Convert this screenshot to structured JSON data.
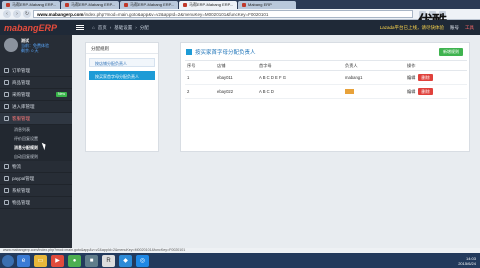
{
  "browser": {
    "tabs": [
      {
        "label": "马帮ERP-Mabang ERP..."
      },
      {
        "label": "马帮ERP-Mabang ERP..."
      },
      {
        "label": "马帮ERP-Mabang ERP..."
      },
      {
        "label": "马帮ERP-Mabang ERP..."
      },
      {
        "label": "Mabang ERP"
      }
    ],
    "url_domain": "www.mabangerp.com",
    "url_path": "/index.php?mod=main.goto&app&v=v2&appId=2&menuKey=M0020101&funcKey=F0020101",
    "status_url": "www.mabangerp.com/index.php?mod=main.goto&app&v=v2&appId=2&menuKey=M0020101&funcKey=F0020101"
  },
  "header": {
    "logo_main": "mabang",
    "logo_accent": "ERP",
    "breadcrumb": [
      "首页",
      "基础设置",
      "分配"
    ],
    "notice": "Lazada平台已上线，请尽快体验",
    "user": "账号",
    "tool": "工具"
  },
  "sidebar": {
    "user_name": "测试",
    "user_line1": "当前：免费体验",
    "user_line2": "剩余: 0 天",
    "items": [
      {
        "label": "订单管理"
      },
      {
        "label": "商品管理"
      },
      {
        "label": "采购管理",
        "badge": "New"
      },
      {
        "label": "进入库管理"
      },
      {
        "label": "客服管理"
      }
    ],
    "subitems": [
      {
        "label": "消息列表"
      },
      {
        "label": "评价回复设置"
      },
      {
        "label": "消息分配规则"
      },
      {
        "label": "自动回复规则"
      }
    ],
    "items_after": [
      {
        "label": "物流"
      },
      {
        "label": "paypal管理"
      },
      {
        "label": "系统管理"
      },
      {
        "label": "物品管理"
      }
    ]
  },
  "left_panel": {
    "title": "分配规则",
    "items": [
      {
        "label": "按店铺分配负责人"
      },
      {
        "label": "按买家首字母分配负责人"
      }
    ]
  },
  "main_panel": {
    "title": "按买家首字母分配负责人",
    "new_button": "新增规则",
    "columns": [
      "序号",
      "店铺",
      "首字母",
      "负责人",
      "操作"
    ],
    "rows": [
      {
        "no": "1",
        "shop": "ebay011",
        "letters": "A B C D E F G",
        "owner": "mabang1",
        "edit": "编辑",
        "delete": "删除"
      },
      {
        "no": "2",
        "shop": "ebay022",
        "letters": "A B C D",
        "owner": "",
        "edit": "编辑",
        "delete": "删除"
      }
    ]
  },
  "taskbar": {
    "time": "14:03",
    "date": "2015/6/24"
  },
  "watermark": "优酷"
}
